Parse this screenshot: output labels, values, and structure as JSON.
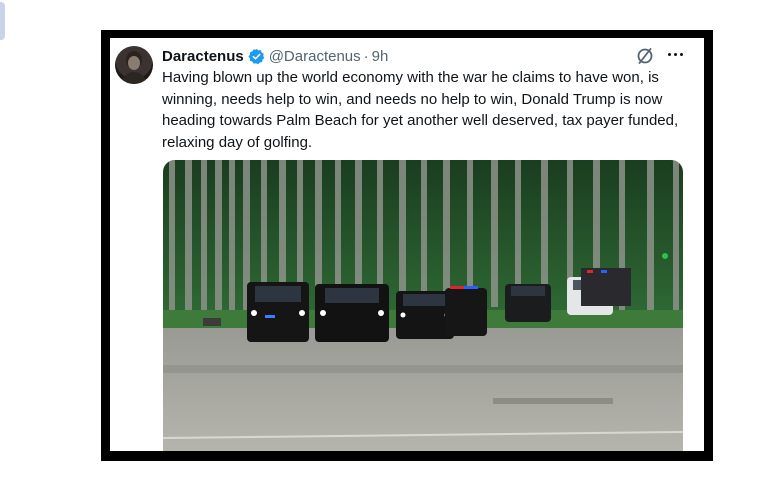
{
  "tweet": {
    "author_name": "Daractenus",
    "handle": "@Daractenus",
    "separator": "·",
    "time": "9h",
    "text": "Having blown up the world economy with the war he claims to have won, is winning, needs help to win, and needs no help to win, Donald Trump is now heading towards Palm Beach for yet another well deserved, tax payer funded, relaxing day of golfing.",
    "verified": true
  },
  "icons": {
    "verified": "verified-badge-icon",
    "grok": "grok-icon",
    "more": "more-options-icon"
  },
  "colors": {
    "verified_blue": "#1d9bf0",
    "text": "#0f1419",
    "secondary_text": "#536471",
    "frame": "#000000"
  }
}
